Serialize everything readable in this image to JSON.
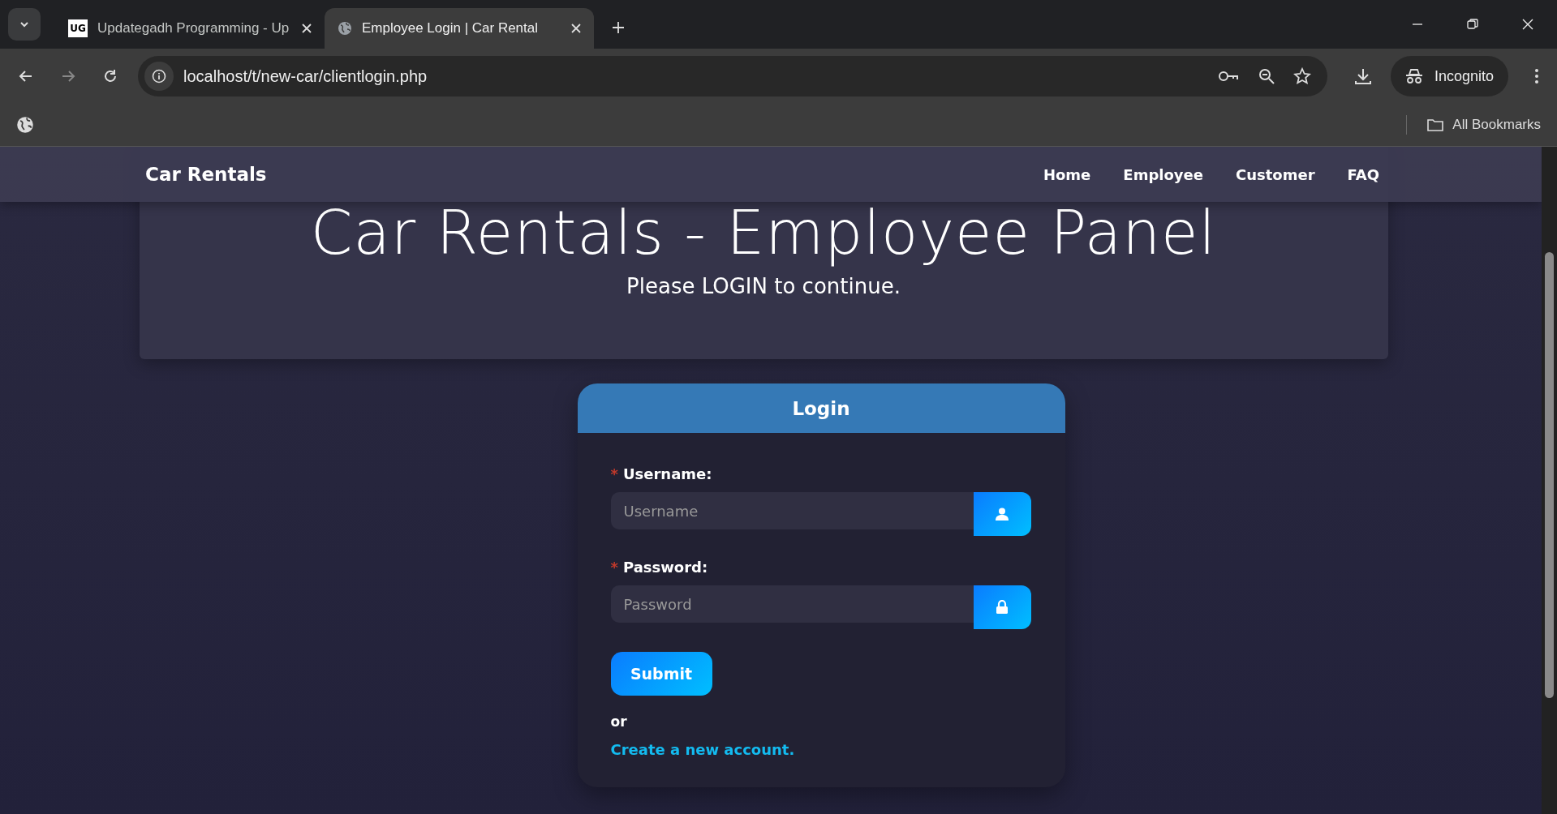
{
  "browser": {
    "tabs": [
      {
        "title": "Updategadh Programming - Up",
        "kind": "logo",
        "logo_text": "UG",
        "selected": false
      },
      {
        "title": "Employee Login | Car Rental",
        "kind": "globe",
        "selected": true
      }
    ],
    "url": "localhost/t/new-car/clientlogin.php",
    "profile": "Incognito",
    "bookmarks": "All Bookmarks"
  },
  "navbar": {
    "brand": "Car Rentals",
    "links": [
      "Home",
      "Employee",
      "Customer",
      "FAQ"
    ]
  },
  "header": {
    "title": "Car Rentals - Employee Panel",
    "subtitle": "Please LOGIN to continue."
  },
  "login": {
    "title": "Login",
    "fields": [
      {
        "label": "Username:",
        "required_mark": "*",
        "placeholder": "Username",
        "kind": "user"
      },
      {
        "label": "Password:",
        "required_mark": "*",
        "placeholder": "Password",
        "kind": "lock"
      }
    ],
    "submit": "Submit",
    "or": "or",
    "link": "Create a new account."
  }
}
